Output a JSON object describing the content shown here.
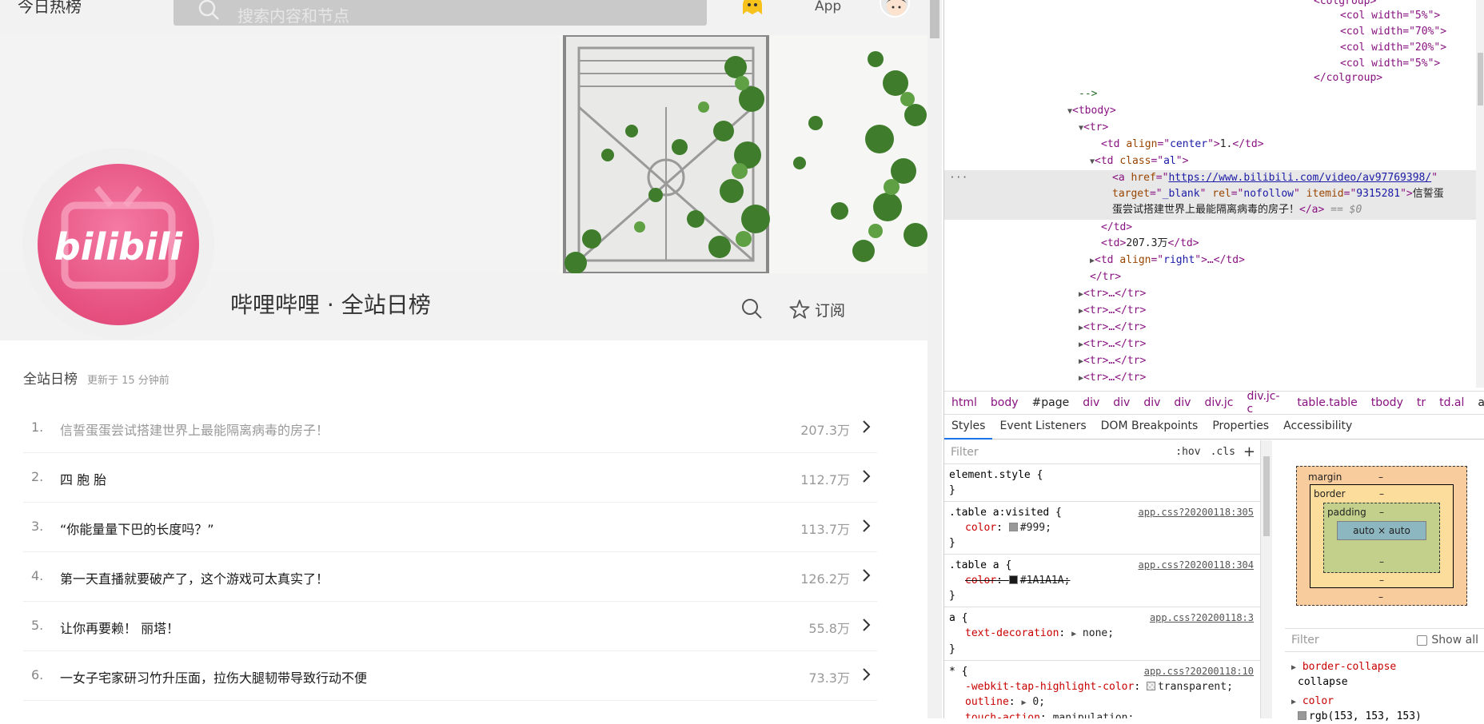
{
  "header": {
    "brand": "今日热榜",
    "search_placeholder": "搜索内容和节点",
    "app_label": "App"
  },
  "node": {
    "title": "哔哩哔哩 · 全站日榜",
    "subscribe_label": "订阅",
    "logo_text": "bilibili"
  },
  "list": {
    "heading": "全站日榜",
    "updated": "更新于 15 分钟前",
    "rows": [
      {
        "num": "1.",
        "title": "信誓蛋蛋尝试搭建世界上最能隔离病毒的房子！",
        "value": "207.3万"
      },
      {
        "num": "2.",
        "title": "四 胞 胎",
        "value": "112.7万"
      },
      {
        "num": "3.",
        "title": "“你能量量下巴的长度吗？”",
        "value": "113.7万"
      },
      {
        "num": "4.",
        "title": "第一天直播就要破产了，这个游戏可太真实了！",
        "value": "126.2万"
      },
      {
        "num": "5.",
        "title": "让你再要赖！ 丽塔！",
        "value": "55.8万"
      },
      {
        "num": "6.",
        "title": "一女子宅家研习竹升压面，拉伤大腿韧带导致行动不便",
        "value": "73.3万"
      }
    ]
  },
  "devtools": {
    "dom": {
      "colgroup_open": "<colgroup>",
      "cols": [
        "<col width=\"5%\">",
        "<col width=\"70%\">",
        "<col width=\"20%\">",
        "<col width=\"5%\">"
      ],
      "colgroup_close": "</colgroup>",
      "comment_end": "-->",
      "tbody": "<tbody>",
      "tr": "<tr>",
      "td_center": "1.",
      "td_class": "al",
      "href": "https://www.bilibili.com/video/av97769398/",
      "target": "_blank",
      "rel": "nofollow",
      "itemid": "9315281",
      "anchor_text_1": "信誓蛋",
      "anchor_text_2": "蛋尝试搭建世界上最能隔离病毒的房子！",
      "eq": "== $0",
      "td_close": "</td>",
      "td_value": "207.3万",
      "td_right_align": "right",
      "tr_close": "</tr>",
      "tr_collapsed": "<tr>…</tr>"
    },
    "breadcrumbs": [
      "html",
      "body",
      "#page",
      "div",
      "div",
      "div",
      "div",
      "div.jc",
      "div.jc-c",
      "table.table",
      "tbody",
      "tr",
      "td.al",
      "a"
    ],
    "tabs": [
      "Styles",
      "Event Listeners",
      "DOM Breakpoints",
      "Properties",
      "Accessibility"
    ],
    "styles": {
      "filter_placeholder": "Filter",
      "hov": ":hov",
      "cls": ".cls",
      "plus": "+",
      "rules": [
        {
          "selector": "element.style {",
          "close": "}",
          "source": "",
          "props": []
        },
        {
          "selector": ".table a:visited {",
          "close": "}",
          "source": "app.css?20200118:305",
          "props": [
            {
              "name": "color",
              "value": "#999;",
              "swatch": "#999999",
              "strike": false
            }
          ]
        },
        {
          "selector": ".table a {",
          "close": "}",
          "source": "app.css?20200118:304",
          "props": [
            {
              "name": "color",
              "value": "#1A1A1A;",
              "swatch": "#1A1A1A",
              "strike": true
            }
          ]
        },
        {
          "selector": "a {",
          "close": "}",
          "source": "app.css?20200118:3",
          "props": [
            {
              "name": "text-decoration",
              "value": "none;",
              "swatch": "",
              "strike": false
            }
          ]
        },
        {
          "selector": "* {",
          "close": "",
          "source": "app.css?20200118:10",
          "props": [
            {
              "name": "-webkit-tap-highlight-color",
              "value": "transparent;",
              "swatch": "transparent",
              "strike": false
            },
            {
              "name": "outline",
              "value": "0;",
              "swatch": "",
              "strike": false
            },
            {
              "name": "touch-action",
              "value": "manipulation;",
              "swatch": "",
              "strike": false
            }
          ]
        }
      ]
    },
    "boxmodel": {
      "margin": "margin",
      "border": "border",
      "padding": "padding",
      "content": "auto × auto",
      "dash": "–"
    },
    "computed": {
      "filter_placeholder": "Filter",
      "show_all": "Show all",
      "props": [
        {
          "name": "border-collapse",
          "value": "collapse"
        },
        {
          "name": "color",
          "value": "rgb(153, 153, 153)"
        }
      ]
    }
  }
}
